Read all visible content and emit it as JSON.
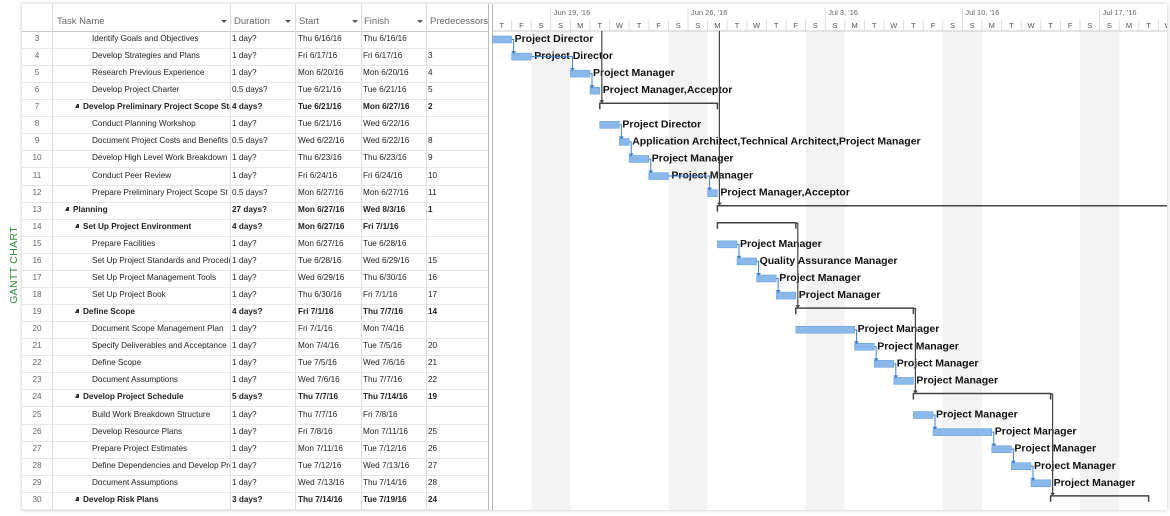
{
  "side_label": "GANTT CHART",
  "columns": {
    "task_name": "Task Name",
    "duration": "Duration",
    "start": "Start",
    "finish": "Finish",
    "predecessors": "Predecessors"
  },
  "timescale": {
    "weeks": [
      "Jun 19, '16",
      "Jun 26, '16",
      "Jul 3, '16",
      "Jul 10, '16",
      "Jul 17, '16"
    ],
    "first_day": "2016-06-16",
    "day_letters": [
      "T",
      "F",
      "S",
      "S",
      "M",
      "T",
      "W",
      "T",
      "F",
      "S",
      "S",
      "M",
      "T",
      "W",
      "T",
      "F",
      "S",
      "S",
      "M",
      "T",
      "W",
      "T",
      "F",
      "S",
      "S",
      "M",
      "T",
      "W",
      "T",
      "F",
      "S",
      "S",
      "M",
      "T",
      "W"
    ]
  },
  "colors": {
    "bar": "#8bb8ea",
    "bar_border": "#5b9ad8",
    "link": "#3a7fd0",
    "summary": "#444444",
    "weekend": "#f3f3f3",
    "side_label": "#2f8a35"
  },
  "rows": [
    {
      "id": "3",
      "name": "Identify Goals and Objectives",
      "duration": "1 day?",
      "start": "Thu 6/16/16",
      "finish": "Thu 6/16/16",
      "pred": "",
      "level": 3,
      "bar": [
        "2016-06-16T00",
        "2016-06-17T00"
      ],
      "resource": "Project Director"
    },
    {
      "id": "4",
      "name": "Develop Strategies and Plans",
      "duration": "1 day?",
      "start": "Fri 6/17/16",
      "finish": "Fri 6/17/16",
      "pred": "3",
      "level": 3,
      "bar": [
        "2016-06-17T00",
        "2016-06-18T00"
      ],
      "resource": "Project Director"
    },
    {
      "id": "5",
      "name": "Research Previous Experience",
      "duration": "1 day?",
      "start": "Mon 6/20/16",
      "finish": "Mon 6/20/16",
      "pred": "4",
      "level": 3,
      "bar": [
        "2016-06-20T00",
        "2016-06-21T00"
      ],
      "resource": "Project Manager"
    },
    {
      "id": "6",
      "name": "Develop Project Charter",
      "duration": "0.5 days?",
      "start": "Tue 6/21/16",
      "finish": "Tue 6/21/16",
      "pred": "5",
      "level": 3,
      "bar": [
        "2016-06-21T00",
        "2016-06-21T12"
      ],
      "resource": "Project Manager,Acceptor"
    },
    {
      "id": "7",
      "name": "Develop Preliminary Project Scope Stat",
      "duration": "4 days?",
      "start": "Tue 6/21/16",
      "finish": "Mon 6/27/16",
      "pred": "2",
      "level": 2,
      "summary": true,
      "bar": [
        "2016-06-21T12",
        "2016-06-27T12"
      ],
      "resource": ""
    },
    {
      "id": "8",
      "name": "Conduct Planning Workshop",
      "duration": "1 day?",
      "start": "Tue 6/21/16",
      "finish": "Wed 6/22/16",
      "pred": "",
      "level": 3,
      "bar": [
        "2016-06-21T12",
        "2016-06-22T12"
      ],
      "resource": "Project Director"
    },
    {
      "id": "9",
      "name": "Document Project Costs and Benefits",
      "duration": "0.5 days?",
      "start": "Wed 6/22/16",
      "finish": "Wed 6/22/16",
      "pred": "8",
      "level": 3,
      "bar": [
        "2016-06-22T12",
        "2016-06-23T00"
      ],
      "resource": "Application Architect,Technical Architect,Project Manager"
    },
    {
      "id": "10",
      "name": "Develop High Level Work Breakdown",
      "duration": "1 day?",
      "start": "Thu 6/23/16",
      "finish": "Thu 6/23/16",
      "pred": "9",
      "level": 3,
      "bar": [
        "2016-06-23T00",
        "2016-06-24T00"
      ],
      "resource": "Project Manager"
    },
    {
      "id": "11",
      "name": "Conduct Peer Review",
      "duration": "1 day?",
      "start": "Fri 6/24/16",
      "finish": "Fri 6/24/16",
      "pred": "10",
      "level": 3,
      "bar": [
        "2016-06-24T00",
        "2016-06-25T00"
      ],
      "resource": "Project Manager"
    },
    {
      "id": "12",
      "name": "Prepare Preliminary Project Scope St",
      "duration": "0.5 days?",
      "start": "Mon 6/27/16",
      "finish": "Mon 6/27/16",
      "pred": "11",
      "level": 3,
      "bar": [
        "2016-06-27T00",
        "2016-06-27T12"
      ],
      "resource": "Project Manager,Acceptor"
    },
    {
      "id": "13",
      "name": "Planning",
      "duration": "27 days?",
      "start": "Mon 6/27/16",
      "finish": "Wed 8/3/16",
      "pred": "1",
      "level": 1,
      "summary": true,
      "bar": [
        "2016-06-27T12",
        "2016-08-03T00"
      ],
      "resource": ""
    },
    {
      "id": "14",
      "name": "Set Up Project Environment",
      "duration": "4 days?",
      "start": "Mon 6/27/16",
      "finish": "Fri 7/1/16",
      "pred": "",
      "level": 2,
      "summary": true,
      "bar": [
        "2016-06-27T12",
        "2016-07-01T12"
      ],
      "resource": ""
    },
    {
      "id": "15",
      "name": "Prepare Facilities",
      "duration": "1 day?",
      "start": "Mon 6/27/16",
      "finish": "Tue 6/28/16",
      "pred": "",
      "level": 3,
      "bar": [
        "2016-06-27T12",
        "2016-06-28T12"
      ],
      "resource": "Project Manager"
    },
    {
      "id": "16",
      "name": "Set Up Project Standards and Procedures",
      "duration": "1 day?",
      "start": "Tue 6/28/16",
      "finish": "Wed 6/29/16",
      "pred": "15",
      "level": 3,
      "bar": [
        "2016-06-28T12",
        "2016-06-29T12"
      ],
      "resource": "Quality Assurance Manager"
    },
    {
      "id": "17",
      "name": "Set Up Project Management Tools",
      "duration": "1 day?",
      "start": "Wed 6/29/16",
      "finish": "Thu 6/30/16",
      "pred": "16",
      "level": 3,
      "bar": [
        "2016-06-29T12",
        "2016-06-30T12"
      ],
      "resource": "Project Manager"
    },
    {
      "id": "18",
      "name": "Set Up Project Book",
      "duration": "1 day?",
      "start": "Thu 6/30/16",
      "finish": "Fri 7/1/16",
      "pred": "17",
      "level": 3,
      "bar": [
        "2016-06-30T12",
        "2016-07-01T12"
      ],
      "resource": "Project Manager"
    },
    {
      "id": "19",
      "name": "Define Scope",
      "duration": "4 days?",
      "start": "Fri 7/1/16",
      "finish": "Thu 7/7/16",
      "pred": "14",
      "level": 2,
      "summary": true,
      "bar": [
        "2016-07-01T12",
        "2016-07-07T12"
      ],
      "resource": ""
    },
    {
      "id": "20",
      "name": "Document Scope Management Plan",
      "duration": "1 day?",
      "start": "Fri 7/1/16",
      "finish": "Mon 7/4/16",
      "pred": "",
      "level": 3,
      "bar": [
        "2016-07-01T12",
        "2016-07-04T12"
      ],
      "resource": "Project Manager"
    },
    {
      "id": "21",
      "name": "Specify Deliverables and Acceptance",
      "duration": "1 day?",
      "start": "Mon 7/4/16",
      "finish": "Tue 7/5/16",
      "pred": "20",
      "level": 3,
      "bar": [
        "2016-07-04T12",
        "2016-07-05T12"
      ],
      "resource": "Project Manager"
    },
    {
      "id": "22",
      "name": "Define Scope",
      "duration": "1 day?",
      "start": "Tue 7/5/16",
      "finish": "Wed 7/6/16",
      "pred": "21",
      "level": 3,
      "bar": [
        "2016-07-05T12",
        "2016-07-06T12"
      ],
      "resource": "Project Manager"
    },
    {
      "id": "23",
      "name": "Document Assumptions",
      "duration": "1 day?",
      "start": "Wed 7/6/16",
      "finish": "Thu 7/7/16",
      "pred": "22",
      "level": 3,
      "bar": [
        "2016-07-06T12",
        "2016-07-07T12"
      ],
      "resource": "Project Manager"
    },
    {
      "id": "24",
      "name": "Develop Project Schedule",
      "duration": "5 days?",
      "start": "Thu 7/7/16",
      "finish": "Thu 7/14/16",
      "pred": "19",
      "level": 2,
      "summary": true,
      "bar": [
        "2016-07-07T12",
        "2016-07-14T12"
      ],
      "resource": ""
    },
    {
      "id": "25",
      "name": "Build Work Breakdown Structure",
      "duration": "1 day?",
      "start": "Thu 7/7/16",
      "finish": "Fri 7/8/16",
      "pred": "",
      "level": 3,
      "bar": [
        "2016-07-07T12",
        "2016-07-08T12"
      ],
      "resource": "Project Manager"
    },
    {
      "id": "26",
      "name": "Develop Resource Plans",
      "duration": "1 day?",
      "start": "Fri 7/8/16",
      "finish": "Mon 7/11/16",
      "pred": "25",
      "level": 3,
      "bar": [
        "2016-07-08T12",
        "2016-07-11T12"
      ],
      "resource": "Project Manager"
    },
    {
      "id": "27",
      "name": "Prepare Project Estimates",
      "duration": "1 day?",
      "start": "Mon 7/11/16",
      "finish": "Tue 7/12/16",
      "pred": "26",
      "level": 3,
      "bar": [
        "2016-07-11T12",
        "2016-07-12T12"
      ],
      "resource": "Project Manager"
    },
    {
      "id": "28",
      "name": "Define Dependencies and Develop Project Schedule",
      "duration": "1 day?",
      "start": "Tue 7/12/16",
      "finish": "Wed 7/13/16",
      "pred": "27",
      "level": 3,
      "bar": [
        "2016-07-12T12",
        "2016-07-13T12"
      ],
      "resource": "Project Manager"
    },
    {
      "id": "29",
      "name": "Document Assumptions",
      "duration": "1 day?",
      "start": "Wed 7/13/16",
      "finish": "Thu 7/14/16",
      "pred": "28",
      "level": 3,
      "bar": [
        "2016-07-13T12",
        "2016-07-14T12"
      ],
      "resource": "Project Manager"
    },
    {
      "id": "30",
      "name": "Develop Risk Plans",
      "duration": "3 days?",
      "start": "Thu 7/14/16",
      "finish": "Tue 7/19/16",
      "pred": "24",
      "level": 2,
      "summary": true,
      "bar": [
        "2016-07-14T12",
        "2016-07-19T12"
      ],
      "resource": ""
    }
  ]
}
